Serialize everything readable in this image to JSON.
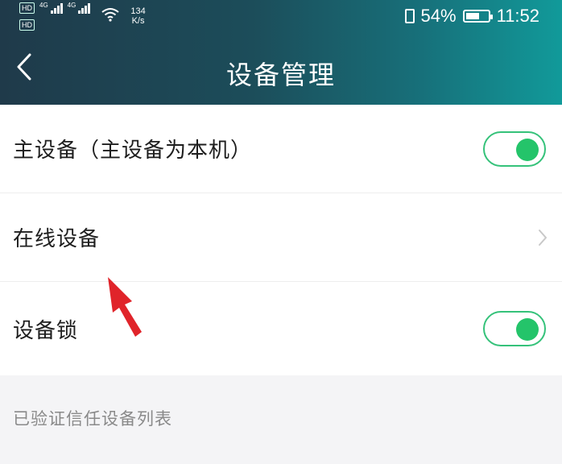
{
  "status_bar": {
    "hd_badge": "HD",
    "sim1_network": "4G",
    "sim2_network": "4G",
    "speed_value": "134",
    "speed_unit": "K/s",
    "battery": "54%",
    "time": "11:52"
  },
  "header": {
    "title": "设备管理",
    "back_icon": "chevron-left-icon"
  },
  "settings": {
    "primary_device": {
      "label": "主设备（主设备为本机）",
      "enabled": true
    },
    "online_devices": {
      "label": "在线设备",
      "icon": "chevron-right-icon"
    },
    "device_lock": {
      "label": "设备锁",
      "enabled": true
    }
  },
  "trusted_section": {
    "title": "已验证信任设备列表"
  },
  "colors": {
    "header_start": "#1f3a4a",
    "header_end": "#119a9a",
    "toggle_on": "#24c46a",
    "annotation_arrow": "#e0242a"
  }
}
